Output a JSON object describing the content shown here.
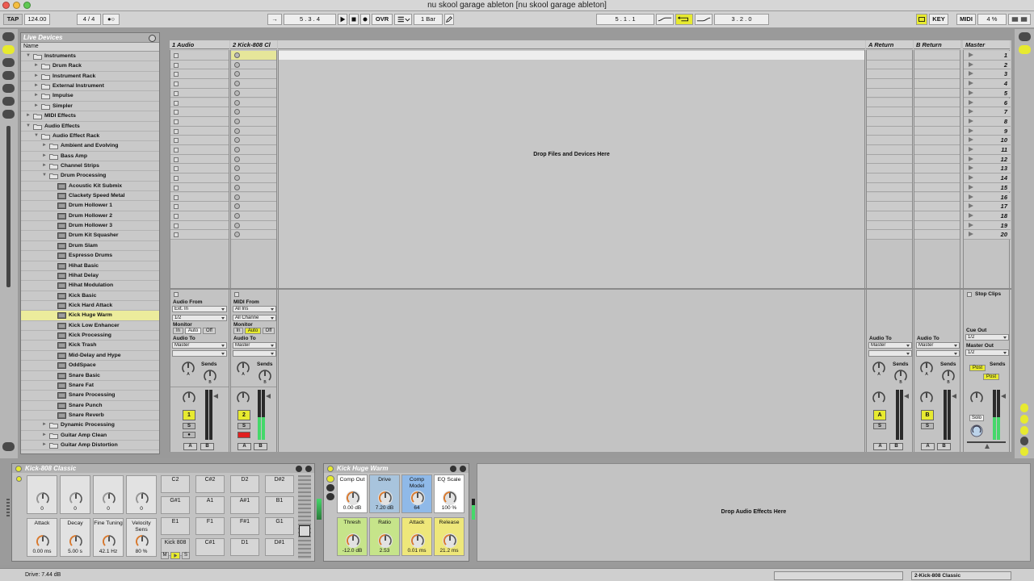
{
  "window": {
    "title": "nu skool garage ableton  [nu skool garage ableton]"
  },
  "transport": {
    "tap": "TAP",
    "tempo": "124.00",
    "signature": "4 / 4",
    "metronome": "●○",
    "follow": "→",
    "position": "5 .  3 .  4",
    "ovr": "OVR",
    "quantization": "1 Bar",
    "loop_start": "5 .  1 .  1",
    "loop_length": "3 .  2 .  0",
    "key": "KEY",
    "midi": "MIDI",
    "cpu": "4 %"
  },
  "browser": {
    "title": "Live Devices",
    "column": "Name",
    "items": [
      {
        "label": "Instruments",
        "level": 0,
        "type": "folder",
        "open": true
      },
      {
        "label": "Drum Rack",
        "level": 1,
        "type": "folder",
        "open": false
      },
      {
        "label": "Instrument Rack",
        "level": 1,
        "type": "folder",
        "open": false
      },
      {
        "label": "External Instrument",
        "level": 1,
        "type": "folder",
        "open": false
      },
      {
        "label": "Impulse",
        "level": 1,
        "type": "folder",
        "open": false
      },
      {
        "label": "Simpler",
        "level": 1,
        "type": "folder",
        "open": false
      },
      {
        "label": "MIDI Effects",
        "level": 0,
        "type": "folder",
        "open": false
      },
      {
        "label": "Audio Effects",
        "level": 0,
        "type": "folder",
        "open": true
      },
      {
        "label": "Audio Effect Rack",
        "level": 1,
        "type": "folder",
        "open": true
      },
      {
        "label": "Ambient and Evolving",
        "level": 2,
        "type": "folder",
        "open": false
      },
      {
        "label": "Bass Amp",
        "level": 2,
        "type": "folder",
        "open": false
      },
      {
        "label": "Channel Strips",
        "level": 2,
        "type": "folder",
        "open": false
      },
      {
        "label": "Drum Processing",
        "level": 2,
        "type": "folder",
        "open": true
      },
      {
        "label": "Acoustic Kit Submix",
        "level": 3,
        "type": "preset"
      },
      {
        "label": "Clackety Speed Metal",
        "level": 3,
        "type": "preset"
      },
      {
        "label": "Drum Hollower 1",
        "level": 3,
        "type": "preset"
      },
      {
        "label": "Drum Hollower 2",
        "level": 3,
        "type": "preset"
      },
      {
        "label": "Drum Hollower 3",
        "level": 3,
        "type": "preset"
      },
      {
        "label": "Drum Kit Squasher",
        "level": 3,
        "type": "preset"
      },
      {
        "label": "Drum Slam",
        "level": 3,
        "type": "preset"
      },
      {
        "label": "Espresso Drums",
        "level": 3,
        "type": "preset"
      },
      {
        "label": "Hihat Basic",
        "level": 3,
        "type": "preset"
      },
      {
        "label": "Hihat Delay",
        "level": 3,
        "type": "preset"
      },
      {
        "label": "Hihat Modulation",
        "level": 3,
        "type": "preset"
      },
      {
        "label": "Kick Basic",
        "level": 3,
        "type": "preset"
      },
      {
        "label": "Kick Hard Attack",
        "level": 3,
        "type": "preset"
      },
      {
        "label": "Kick Huge Warm",
        "level": 3,
        "type": "preset",
        "selected": true
      },
      {
        "label": "Kick Low Enhancer",
        "level": 3,
        "type": "preset"
      },
      {
        "label": "Kick Processing",
        "level": 3,
        "type": "preset"
      },
      {
        "label": "Kick Trash",
        "level": 3,
        "type": "preset"
      },
      {
        "label": "Mid-Delay and Hype",
        "level": 3,
        "type": "preset"
      },
      {
        "label": "OddSpace",
        "level": 3,
        "type": "preset"
      },
      {
        "label": "Snare Basic",
        "level": 3,
        "type": "preset"
      },
      {
        "label": "Snare Fat",
        "level": 3,
        "type": "preset"
      },
      {
        "label": "Snare Processing",
        "level": 3,
        "type": "preset"
      },
      {
        "label": "Snare Punch",
        "level": 3,
        "type": "preset"
      },
      {
        "label": "Snare Reverb",
        "level": 3,
        "type": "preset"
      },
      {
        "label": "Dynamic Processing",
        "level": 2,
        "type": "folder",
        "open": false
      },
      {
        "label": "Guitar Amp Clean",
        "level": 2,
        "type": "folder",
        "open": false
      },
      {
        "label": "Guitar Amp Distortion",
        "level": 2,
        "type": "folder",
        "open": false
      }
    ]
  },
  "session": {
    "tracks": [
      {
        "name": "1 Audio",
        "number": "1",
        "input_label": "Audio From",
        "input_type": "Ext. In",
        "input_channel": "1/2"
      },
      {
        "name": "2 Kick-808 Cl",
        "number": "2",
        "input_label": "MIDI From",
        "input_type": "All Ins",
        "input_channel": "All Channe"
      }
    ],
    "returns": [
      {
        "name": "A Return",
        "letter": "A"
      },
      {
        "name": "B Return",
        "letter": "B"
      }
    ],
    "master": {
      "name": "Master",
      "scenes": [
        "1",
        "2",
        "3",
        "4",
        "5",
        "6",
        "7",
        "8",
        "9",
        "10",
        "11",
        "12",
        "13",
        "14",
        "15",
        "16",
        "17",
        "18",
        "19",
        "20"
      ]
    },
    "drop_text": "Drop Files and Devices Here",
    "stop_clips": "Stop Clips",
    "monitor": {
      "label": "Monitor",
      "in": "In",
      "auto": "Auto",
      "off": "Off"
    },
    "audio_to": {
      "label": "Audio To",
      "value": "Master"
    },
    "sends": "Sends",
    "cue_out": {
      "label": "Cue Out",
      "value": "1/2"
    },
    "master_out": {
      "label": "Master Out",
      "value": "1/2"
    },
    "post": "Post",
    "solo": "Solo",
    "solo_btn": "S",
    "arm_btn": "●",
    "knob_a": "A",
    "knob_b": "B"
  },
  "devices": {
    "instrument": {
      "title": "Kick-808 Classic",
      "macros_top": [
        {
          "label": "",
          "value": "0"
        },
        {
          "label": "",
          "value": "0"
        },
        {
          "label": "",
          "value": "0"
        },
        {
          "label": "",
          "value": "0"
        }
      ],
      "macros_bottom": [
        {
          "label": "Attack",
          "value": "0.00 ms"
        },
        {
          "label": "Decay",
          "value": "5.00 s"
        },
        {
          "label": "Fine Tuning",
          "value": "42.1 Hz"
        },
        {
          "label": "Velocity Sens",
          "value": "80 %"
        }
      ],
      "pads": [
        [
          "C2",
          "C#2",
          "D2",
          "D#2"
        ],
        [
          "G#1",
          "A1",
          "A#1",
          "B1"
        ],
        [
          "E1",
          "F1",
          "F#1",
          "G1"
        ],
        [
          "Kick 808",
          "C#1",
          "D1",
          "D#1"
        ]
      ],
      "pad_m": "M",
      "pad_s": "S"
    },
    "effect": {
      "title": "Kick Huge Warm",
      "macros_top": [
        {
          "label": "Comp Out",
          "value": "0.00 dB",
          "color": "#ffffff"
        },
        {
          "label": "Drive",
          "value": "7.20 dB",
          "color": "#a8c4dd"
        },
        {
          "label": "Comp Model",
          "value": "64",
          "color": "#8fb9e8"
        },
        {
          "label": "EQ Scale",
          "value": "100 %",
          "color": "#ffffff"
        }
      ],
      "macros_bottom": [
        {
          "label": "Thresh",
          "value": "-12.0 dB",
          "color": "#c6e48a"
        },
        {
          "label": "Ratio",
          "value": "2.53",
          "color": "#c6e48a"
        },
        {
          "label": "Attack",
          "value": "0.01 ms",
          "color": "#eee77a"
        },
        {
          "label": "Release",
          "value": "21.2 ms",
          "color": "#eee77a"
        }
      ]
    },
    "drop_text": "Drop Audio Effects Here"
  },
  "status": {
    "text": "Drive: 7.44 dB",
    "track": "2-Kick-808 Classic"
  },
  "colors": {
    "accent": "#e7ea30",
    "selection": "#ecec9c",
    "meter_green": "#45d86a",
    "record": "#e02020"
  }
}
